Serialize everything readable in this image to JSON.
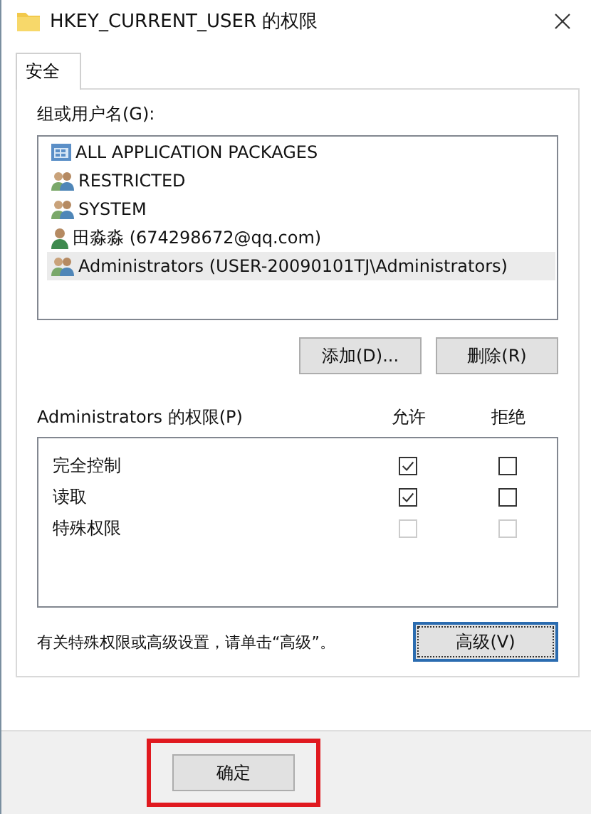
{
  "window": {
    "title": "HKEY_CURRENT_USER 的权限"
  },
  "tabs": [
    {
      "label": "安全",
      "selected": true
    }
  ],
  "groups": {
    "label": "组或用户名(G):",
    "items": [
      {
        "kind": "package",
        "name": "ALL APPLICATION PACKAGES",
        "selected": false
      },
      {
        "kind": "group",
        "name": "RESTRICTED",
        "selected": false
      },
      {
        "kind": "group",
        "name": "SYSTEM",
        "selected": false
      },
      {
        "kind": "user",
        "name": "田淼淼 (674298672@qq.com)",
        "selected": false
      },
      {
        "kind": "group",
        "name": "Administrators (USER-20090101TJ\\Administrators)",
        "selected": true
      }
    ]
  },
  "group_buttons": [
    "添加(D)...",
    "删除(R)"
  ],
  "permissions": {
    "label": "Administrators 的权限(P)",
    "allow_header": "允许",
    "deny_header": "拒绝",
    "rows": [
      {
        "name": "完全控制",
        "allow": {
          "checked": true,
          "disabled": false
        },
        "deny": {
          "checked": false,
          "disabled": false
        }
      },
      {
        "name": "读取",
        "allow": {
          "checked": true,
          "disabled": false
        },
        "deny": {
          "checked": false,
          "disabled": false
        }
      },
      {
        "name": "特殊权限",
        "allow": {
          "checked": false,
          "disabled": true
        },
        "deny": {
          "checked": false,
          "disabled": true
        }
      }
    ]
  },
  "advanced": {
    "hint": "有关特殊权限或高级设置，请单击“高级”。",
    "button": "高级(V)"
  },
  "footer": {
    "buttons": [
      {
        "label": "确定",
        "highlighted": true
      }
    ]
  }
}
